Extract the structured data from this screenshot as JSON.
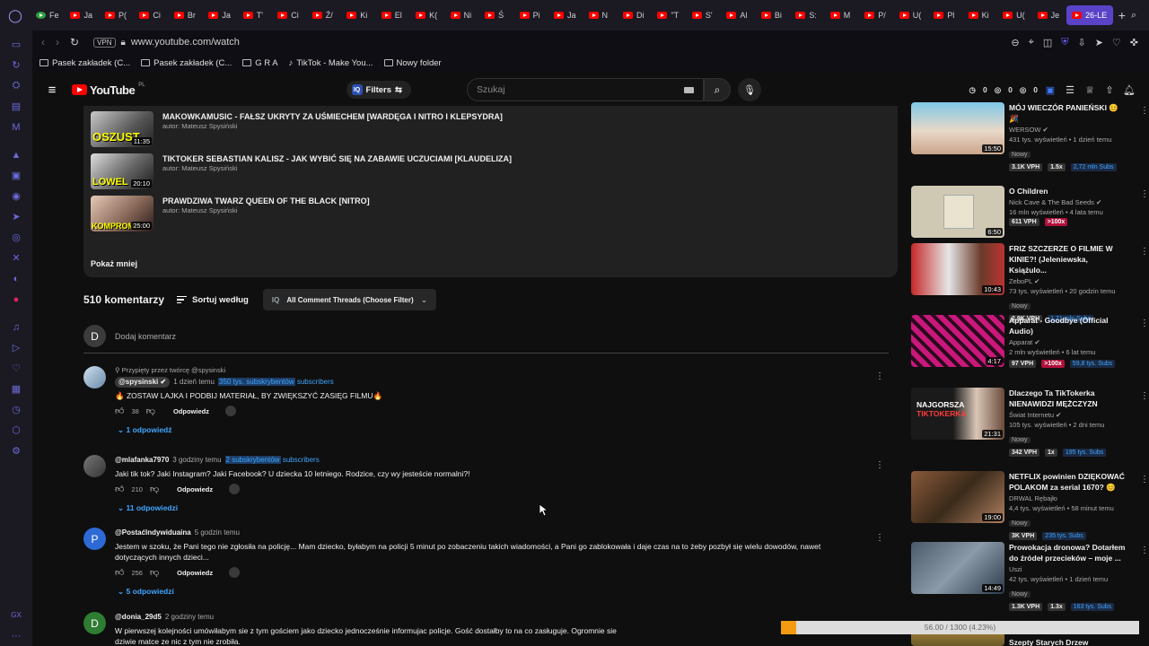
{
  "browser": {
    "tabs": [
      "Fe",
      "Ja",
      "P(",
      "Ci",
      "Br",
      "Ja",
      "T'",
      "Ci",
      "Ź/",
      "Ki",
      "El",
      "K(",
      "Ni",
      "Ś",
      "Pi",
      "Ja",
      "N",
      "Di",
      "\"T",
      "S'",
      "Al",
      "Bi",
      "S:",
      "M",
      "P/",
      "U(",
      "Pl",
      "Ki",
      "U(",
      "Je",
      "26-LE"
    ],
    "active_tab_index": 30,
    "url": "www.youtube.com/watch",
    "vpn_label": "VPN",
    "bookmarks": [
      "Pasek zakładek (C...",
      "Pasek zakładek (C...",
      "G R A",
      "TikTok - Make You...",
      "Nowy folder"
    ]
  },
  "youtube": {
    "logo_text": "YouTube",
    "logo_country": "PL",
    "filters_label": "Filters",
    "search_placeholder": "Szukaj",
    "header_stats": [
      "0",
      "0",
      "0"
    ]
  },
  "playlist": {
    "items": [
      {
        "title": "MAKOWKAMUSIC - FAŁSZ UKRYTY ZA UŚMIECHEM [WARDĘGA I NITRO I KLEPSYDRA]",
        "author": "autor: Mateusz Spysiński",
        "duration": "11:35",
        "thumb_text": "OSZUST"
      },
      {
        "title": "TIKTOKER SEBASTIAN KALISZ - JAK WYBIĆ SIĘ NA ZABAWIE UCZUCIAMI [KLAUDELIZA]",
        "author": "autor: Mateusz Spysiński",
        "duration": "20:10",
        "thumb_text": "LOWEL"
      },
      {
        "title": "PRAWDZIWA TWARZ QUEEN OF THE BLACK [NITRO]",
        "author": "autor: Mateusz Spysiński",
        "duration": "25:00",
        "thumb_text": "KOMPROMI"
      }
    ],
    "show_less": "Pokaż mniej"
  },
  "comments_header": {
    "count": "510 komentarzy",
    "sort_label": "Sortuj według",
    "filter_label": "All Comment Threads (Choose Filter)",
    "add_placeholder": "Dodaj komentarz",
    "user_initial": "D"
  },
  "comments": [
    {
      "pinned": "Przypięty przez twórcę @spysinski",
      "user": "@spysinski",
      "time": "1 dzień temu",
      "subs_count": "350 tys. subskrybentów",
      "subs_word": "subscribers",
      "text": "🔥 ZOSTAW LAJKA I PODBIJ MATERIAŁ, BY ZWIĘKSZYĆ ZASIĘG FILMU🔥",
      "likes": "38",
      "reply": "Odpowiedz",
      "replies": "1 odpowiedź",
      "initial": ""
    },
    {
      "user": "@mlafanka7970",
      "time": "3 godziny temu",
      "subs_count": "2 subskrybentów",
      "subs_word": "subscribers",
      "text": "Jaki tik tok? Jaki Instagram? Jaki Facebook? U dziecka 10 letniego. Rodzice, czy wy jesteście normalni?!",
      "likes": "210",
      "reply": "Odpowiedz",
      "replies": "11 odpowiedzi",
      "initial": ""
    },
    {
      "user": "@Postaćlndywiduaina",
      "time": "5 godzin temu",
      "text": "Jestem w szoku, że Pani tego nie zgłosiła na policję... Mam dziecko, byłabym na policji 5 minut po zobaczeniu takich wiadomości, a Pani go zablokowała i daje czas na to żeby pozbył się wielu dowodów, nawet dotyczących innych dzieci...",
      "likes": "256",
      "reply": "Odpowiedz",
      "replies": "5 odpowiedzi",
      "initial": "P"
    },
    {
      "user": "@donia_29d5",
      "time": "2 godziny temu",
      "text": "W pierwszej kolejności umówiłabym sie z tym gościem jako dziecko jednocześnie informujac policje. Gość dostałby to na co zasługuje. Ogromnie sie dziwie matce ze nic z tym nie zrobiła.",
      "initial": "D"
    }
  ],
  "related": [
    {
      "title": "MÓJ WIECZÓR PANIEŃSKI 😊 🎉",
      "channel": "WERSOW",
      "views": "431 tys. wyświetleń",
      "age": "1 dzień temu",
      "new": "Nowy",
      "vph": "3.1K VPH",
      "mult": "1.5x",
      "subs": "2,72 mln Subs",
      "duration": "15:50"
    },
    {
      "title": "O Children",
      "channel": "Nick Cave & The Bad Seeds",
      "views": "16 mln wyświetleń",
      "age": "4 lata temu",
      "vph": "611 VPH",
      "mult": ">100x",
      "duration": "6:50"
    },
    {
      "title": "FRIZ SZCZERZE O FILMIE W KINIE?! (Jeleniewska, Książulo...",
      "channel": "ZeboPL",
      "views": "73 tys. wyświetleń",
      "age": "20 godzin temu",
      "new": "Nowy",
      "vph": "2.9K VPH",
      "subs": "1,71 mln Subs",
      "duration": "10:43"
    },
    {
      "title": "Apparat - Goodbye (Official Audio)",
      "channel": "Apparat",
      "views": "2 mln wyświetleń",
      "age": "6 lat temu",
      "vph": "97 VPH",
      "mult": ">100x",
      "subs": "59,8 tys. Subs",
      "duration": "4:17"
    },
    {
      "title": "Dlaczego Ta TikTokerka NIENAWIDZI MĘŻCZYZN",
      "channel": "Świat Internetu",
      "views": "105 tys. wyświetleń",
      "age": "2 dni temu",
      "new": "Nowy",
      "vph": "342 VPH",
      "mult": "1x",
      "subs": "195 tys. Subs",
      "duration": "21:31"
    },
    {
      "title": "NETFLIX powinien DZIĘKOWAĆ POLAKOM za serial 1670? 😊",
      "channel": "DRWAL Rębajło",
      "views": "4,4 tys. wyświetleń",
      "age": "58 minut temu",
      "new": "Nowy",
      "vph": "3K VPH",
      "subs": "235 tys. Subs",
      "duration": "19:00"
    },
    {
      "title": "Prowokacja dronowa? Dotarłem do źródeł przecieków – moje ...",
      "channel": "Uszi",
      "views": "42 tys. wyświetleń",
      "age": "1 dzień temu",
      "new": "Nowy",
      "vph": "1.3K VPH",
      "mult": "1.3x",
      "subs": "163 tys. Subs",
      "duration": "14:49"
    },
    {
      "title": "Szepty Starych Drzew",
      "channel": "",
      "views": "",
      "age": "",
      "duration": ""
    }
  ],
  "download": {
    "text": "56.00 / 1300 (4.23%)",
    "fraction": 0.0423
  }
}
